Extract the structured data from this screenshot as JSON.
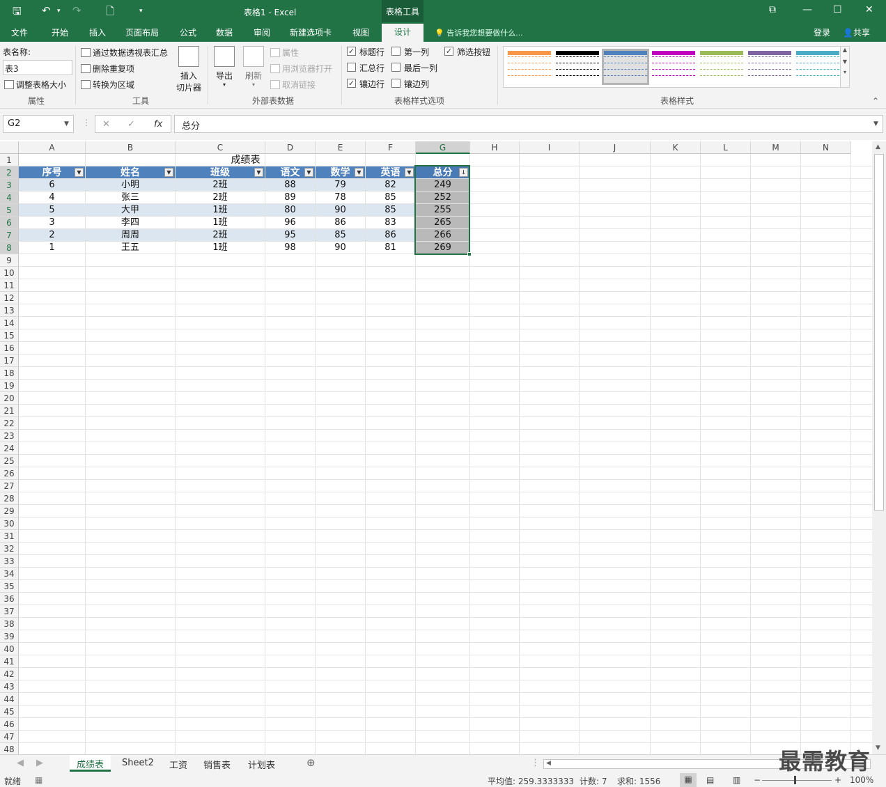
{
  "window": {
    "title": "表格1 - Excel",
    "context_tab": "表格工具"
  },
  "tabs": [
    "文件",
    "开始",
    "插入",
    "页面布局",
    "公式",
    "数据",
    "审阅",
    "新建选项卡",
    "视图"
  ],
  "active_tab": "设计",
  "tell_me": "告诉我您想要做什么...",
  "login": "登录",
  "share": "共享",
  "ribbon": {
    "props": {
      "name_label": "表名称:",
      "name_value": "表3",
      "resize": "调整表格大小",
      "label": "属性"
    },
    "tools": {
      "pivot": "通过数据透视表汇总",
      "dedupe": "删除重复项",
      "to_range": "转换为区域",
      "slicer_1": "插入",
      "slicer_2": "切片器",
      "label": "工具"
    },
    "external": {
      "export": "导出",
      "refresh": "刷新",
      "properties": "属性",
      "open_browser": "用浏览器打开",
      "unlink": "取消链接",
      "label": "外部表数据"
    },
    "style_options": {
      "header_row": "标题行",
      "total_row": "汇总行",
      "banded_rows": "镶边行",
      "first_col": "第一列",
      "last_col": "最后一列",
      "banded_cols": "镶边列",
      "filter_btn": "筛选按钮",
      "label": "表格样式选项"
    },
    "styles": {
      "label": "表格样式",
      "swatches": [
        {
          "color": "#f79646",
          "selected": false
        },
        {
          "color": "#000000",
          "selected": false
        },
        {
          "color": "#4f81bd",
          "selected": true
        },
        {
          "color": "#c000c0",
          "selected": false
        },
        {
          "color": "#9bbb59",
          "selected": false
        },
        {
          "color": "#8064a2",
          "selected": false
        },
        {
          "color": "#4bacc6",
          "selected": false
        }
      ]
    }
  },
  "formula": {
    "namebox": "G2",
    "fx": "fx",
    "content": "总分"
  },
  "sheet": {
    "columns": [
      "A",
      "B",
      "C",
      "D",
      "E",
      "F",
      "G",
      "H",
      "I",
      "J",
      "K",
      "L",
      "M",
      "N"
    ],
    "row_count": 48,
    "title": "成绩表",
    "headers": [
      "序号",
      "姓名",
      "班级",
      "语文",
      "数学",
      "英语",
      "总分"
    ],
    "rows": [
      [
        "6",
        "小明",
        "2班",
        "88",
        "79",
        "82",
        "249"
      ],
      [
        "4",
        "张三",
        "2班",
        "89",
        "78",
        "85",
        "252"
      ],
      [
        "5",
        "大甲",
        "1班",
        "80",
        "90",
        "85",
        "255"
      ],
      [
        "3",
        "李四",
        "1班",
        "96",
        "86",
        "83",
        "265"
      ],
      [
        "2",
        "周周",
        "2班",
        "95",
        "85",
        "86",
        "266"
      ],
      [
        "1",
        "王五",
        "1班",
        "98",
        "90",
        "81",
        "269"
      ]
    ]
  },
  "sheet_tabs": [
    "成绩表",
    "Sheet2",
    "工资",
    "销售表",
    "计划表"
  ],
  "status": {
    "ready": "就绪",
    "average": "平均值: 259.3333333",
    "count": "计数: 7",
    "sum": "求和: 1556",
    "zoom": "100%"
  },
  "watermark": "最需教育",
  "colors": {
    "accent": "#217346",
    "table_header": "#4f81bd",
    "band": "#dce6f1"
  }
}
